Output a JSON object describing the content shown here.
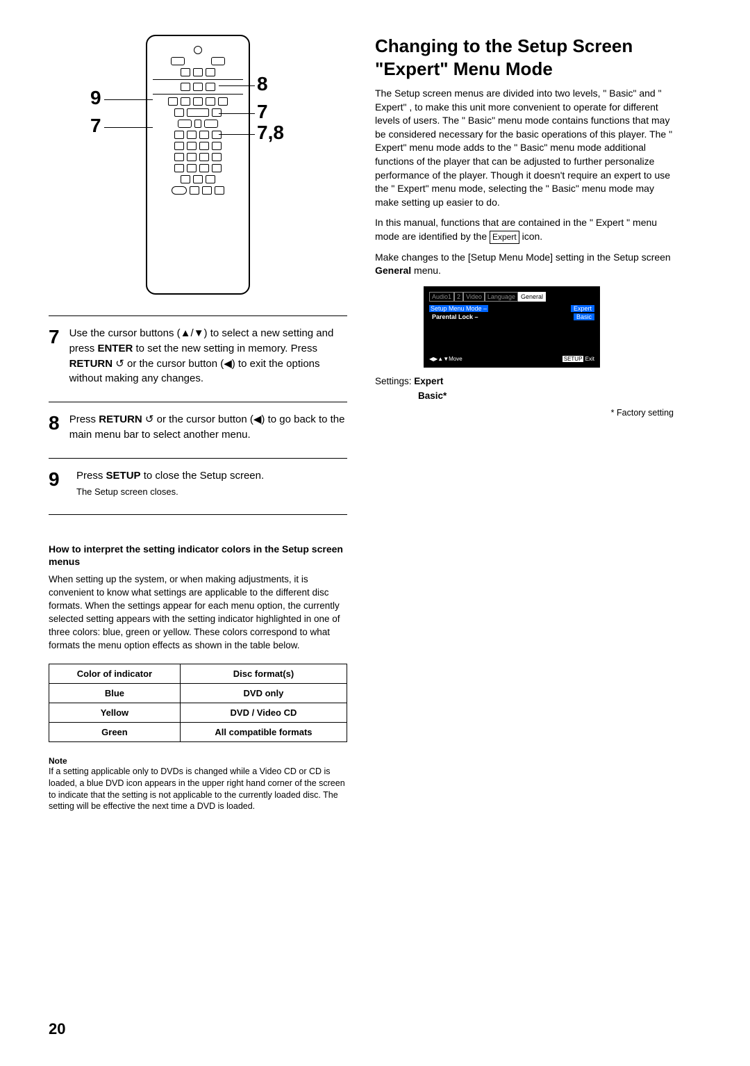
{
  "remote": {
    "labels": {
      "tl": "9",
      "bl": "7",
      "tr": "8",
      "mr": "7",
      "br": "7,8"
    }
  },
  "steps": [
    {
      "n": "7",
      "text": "Use the cursor buttons (▲/▼) to select a new setting and press ENTER to set the new setting in memory. Press RETURN ↺ or the cursor button (◀) to exit the options without making any changes."
    },
    {
      "n": "8",
      "text": "Press RETURN ↺ or the cursor button (◀) to go back to the main menu bar to select another menu."
    },
    {
      "n": "9",
      "text": "Press SETUP to close the Setup screen.",
      "sub": "The Setup screen closes."
    }
  ],
  "subhead": "How to interpret the setting indicator colors in the Setup screen menus",
  "subbody": "When setting up the system, or when making adjustments, it is convenient to know what settings are applicable to the different disc formats. When the settings appear for each menu option, the currently selected setting appears with the setting indicator highlighted in one of three colors: blue, green or yellow. These colors correspond to what formats the menu option effects as shown in the table below.",
  "table": {
    "headers": [
      "Color of indicator",
      "Disc format(s)"
    ],
    "rows": [
      [
        "Blue",
        "DVD only"
      ],
      [
        "Yellow",
        "DVD / Video CD"
      ],
      [
        "Green",
        "All compatible formats"
      ]
    ]
  },
  "note": {
    "head": "Note",
    "body": "If a setting applicable only to DVDs is changed while a Video CD or CD is loaded, a blue DVD icon appears in the upper right hand corner of the screen to indicate that the setting is not applicable to the currently loaded disc. The setting will be effective the next time a DVD is loaded."
  },
  "page_number": "20",
  "right": {
    "title": "Changing to the Setup Screen \"Expert\" Menu Mode",
    "p1": "The Setup screen menus are divided into two levels, \" Basic\" and \" Expert\" , to make this unit more convenient to operate for different levels of users. The \" Basic\" menu mode contains functions that may be considered necessary for the basic operations of this player. The \" Expert\" menu mode adds to the \" Basic\" menu mode additional functions of the player that can be adjusted to further personalize performance of the player. Though it doesn't require an expert to use the \" Expert\" menu mode, selecting the \" Basic\" menu mode may make setting up easier to do.",
    "p2_a": "In this manual, functions that are contained in the \" Expert \" menu mode are identified by the ",
    "p2_icon": "Expert",
    "p2_b": " icon.",
    "p3": "Make changes to the [Setup Menu Mode] setting in the Setup screen General menu.",
    "osd": {
      "tabs": [
        "Audio1",
        "2",
        "Video",
        "Language",
        "General"
      ],
      "row1": {
        "label": "Setup Menu Mode –",
        "val": "Expert"
      },
      "row2": {
        "label": "Parental Lock –",
        "val": "Basic"
      },
      "move": "Move",
      "setup": "SETUP",
      "exit": "Exit"
    },
    "settings_label": "Settings:",
    "settings_expert": "Expert",
    "settings_basic": "Basic*",
    "factory": "* Factory setting"
  }
}
